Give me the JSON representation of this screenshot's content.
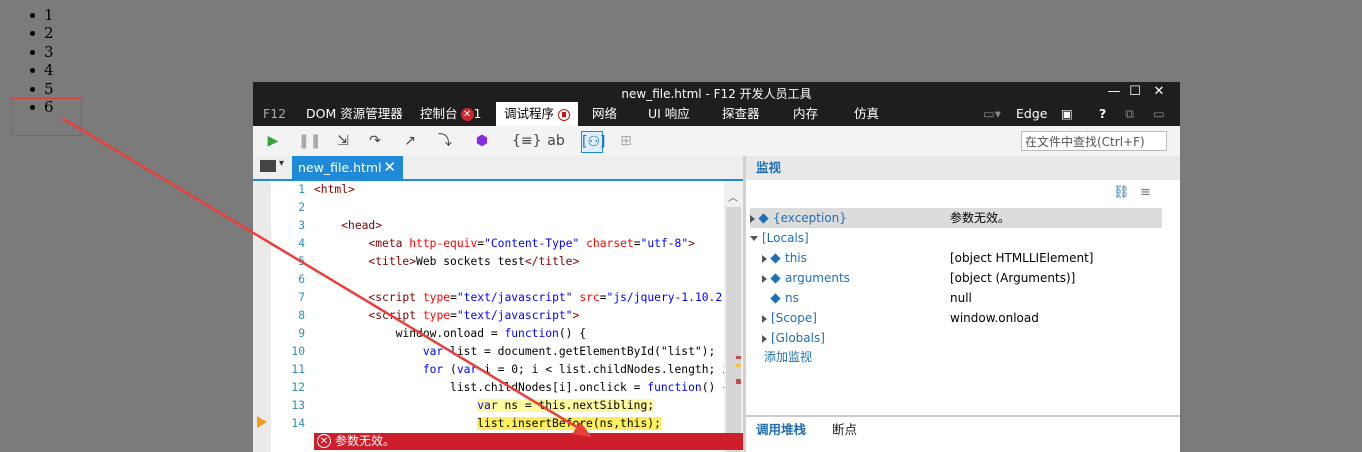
{
  "page_list": [
    "1",
    "2",
    "3",
    "4",
    "5",
    "6"
  ],
  "devtools": {
    "title": "new_file.html - F12 开发人员工具",
    "tabs": {
      "f12": "F12",
      "dom": "DOM 资源管理器",
      "console": "控制台",
      "console_errors": "1",
      "debugger": "调试程序",
      "network": "网络",
      "ui": "UI 响应",
      "profiler": "探查器",
      "memory": "内存",
      "emulation": "仿真",
      "edge": "Edge",
      "help": "?"
    },
    "search_placeholder": "在文件中查找(Ctrl+F)",
    "file_tab": "new_file.html",
    "code_lines": [
      {
        "n": "1"
      },
      {
        "n": "2"
      },
      {
        "n": "3"
      },
      {
        "n": "4"
      },
      {
        "n": "5"
      },
      {
        "n": "6"
      },
      {
        "n": "7"
      },
      {
        "n": "8"
      },
      {
        "n": "9"
      },
      {
        "n": "10"
      },
      {
        "n": "11"
      },
      {
        "n": "12"
      },
      {
        "n": "13"
      },
      {
        "n": "14"
      }
    ],
    "error_message": "参数无效。",
    "watch": {
      "header": "监视",
      "rows": [
        {
          "name": "{exception}",
          "value": "参数无效。"
        },
        {
          "name": "[Locals]",
          "value": ""
        },
        {
          "name": "this",
          "value": "[object HTMLLIElement]"
        },
        {
          "name": "arguments",
          "value": "[object (Arguments)]"
        },
        {
          "name": "ns",
          "value": "null"
        },
        {
          "name": "[Scope]",
          "value": "window.onload"
        },
        {
          "name": "[Globals]",
          "value": ""
        }
      ],
      "add_watch": "添加监视"
    },
    "bottom_tabs": {
      "callstack": "调用堆栈",
      "breakpoints": "断点"
    }
  },
  "colors": {
    "accent": "#1f8ad8",
    "error": "#cd1e2a",
    "annotation": "#e03b3b"
  }
}
